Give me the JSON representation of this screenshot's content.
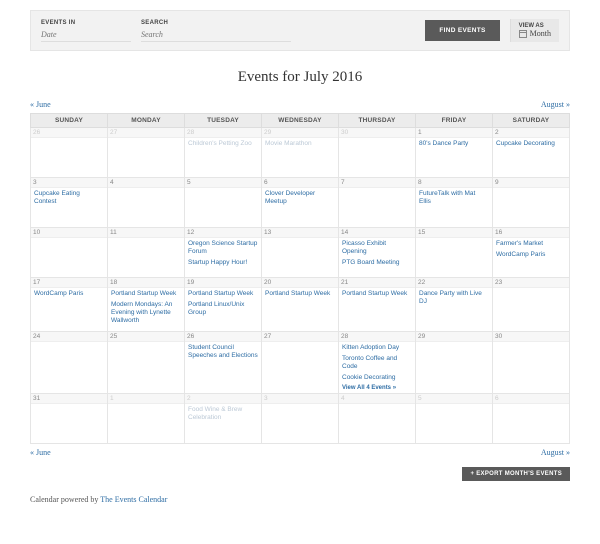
{
  "filters": {
    "events_in_label": "EVENTS IN",
    "events_in_placeholder": "Date",
    "search_label": "SEARCH",
    "search_placeholder": "Search",
    "find_button": "FIND EVENTS",
    "view_as_label": "VIEW AS",
    "view_as_value": "Month"
  },
  "title": "Events for July 2016",
  "nav": {
    "prev": "« June",
    "next": "August »"
  },
  "dow": [
    "SUNDAY",
    "MONDAY",
    "TUESDAY",
    "WEDNESDAY",
    "THURSDAY",
    "FRIDAY",
    "SATURDAY"
  ],
  "weeks": [
    [
      {
        "n": "26",
        "other": true,
        "events": []
      },
      {
        "n": "27",
        "other": true,
        "events": []
      },
      {
        "n": "28",
        "other": true,
        "events": [
          "Children's Petting Zoo"
        ]
      },
      {
        "n": "29",
        "other": true,
        "events": [
          "Movie Marathon"
        ]
      },
      {
        "n": "30",
        "other": true,
        "events": []
      },
      {
        "n": "1",
        "events": [
          "80's Dance Party"
        ]
      },
      {
        "n": "2",
        "events": [
          "Cupcake Decorating"
        ]
      }
    ],
    [
      {
        "n": "3",
        "events": [
          "Cupcake Eating Contest"
        ]
      },
      {
        "n": "4",
        "events": []
      },
      {
        "n": "5",
        "events": []
      },
      {
        "n": "6",
        "events": [
          "Clover Developer Meetup"
        ]
      },
      {
        "n": "7",
        "events": []
      },
      {
        "n": "8",
        "events": [
          "FutureTalk with Mat Ellis"
        ]
      },
      {
        "n": "9",
        "events": []
      }
    ],
    [
      {
        "n": "10",
        "events": []
      },
      {
        "n": "11",
        "events": []
      },
      {
        "n": "12",
        "events": [
          "Oregon Science Startup Forum",
          "Startup Happy Hour!"
        ]
      },
      {
        "n": "13",
        "events": []
      },
      {
        "n": "14",
        "events": [
          "Picasso Exhibit Opening",
          "PTG Board Meeting"
        ]
      },
      {
        "n": "15",
        "events": []
      },
      {
        "n": "16",
        "events": [
          "Farmer's Market",
          "WordCamp Paris"
        ]
      }
    ],
    [
      {
        "n": "17",
        "events": [
          "WordCamp Paris"
        ]
      },
      {
        "n": "18",
        "events": [
          "Portland Startup Week",
          "Modern Mondays: An Evening with Lynette Wallworth"
        ]
      },
      {
        "n": "19",
        "events": [
          "Portland Startup Week",
          "Portland Linux/Unix Group"
        ]
      },
      {
        "n": "20",
        "events": [
          "Portland Startup Week"
        ]
      },
      {
        "n": "21",
        "events": [
          "Portland Startup Week"
        ]
      },
      {
        "n": "22",
        "events": [
          "Dance Party with Live DJ"
        ]
      },
      {
        "n": "23",
        "events": []
      }
    ],
    [
      {
        "n": "24",
        "events": []
      },
      {
        "n": "25",
        "events": []
      },
      {
        "n": "26",
        "events": [
          "Student Council Speeches and Elections"
        ]
      },
      {
        "n": "27",
        "events": []
      },
      {
        "n": "28",
        "events": [
          "Kitten Adoption Day",
          "Toronto Coffee and Code",
          "Cookie Decorating"
        ],
        "view_all": "View All 4 Events »"
      },
      {
        "n": "29",
        "events": []
      },
      {
        "n": "30",
        "events": []
      }
    ],
    [
      {
        "n": "31",
        "events": []
      },
      {
        "n": "1",
        "other": true,
        "events": []
      },
      {
        "n": "2",
        "other": true,
        "events": [
          "Food Wine & Brew Celebration"
        ]
      },
      {
        "n": "3",
        "other": true,
        "events": []
      },
      {
        "n": "4",
        "other": true,
        "events": []
      },
      {
        "n": "5",
        "other": true,
        "events": []
      },
      {
        "n": "6",
        "other": true,
        "events": []
      }
    ]
  ],
  "export_button": "+ EXPORT MONTH'S EVENTS",
  "powered_prefix": "Calendar powered by ",
  "powered_link": "The Events Calendar"
}
